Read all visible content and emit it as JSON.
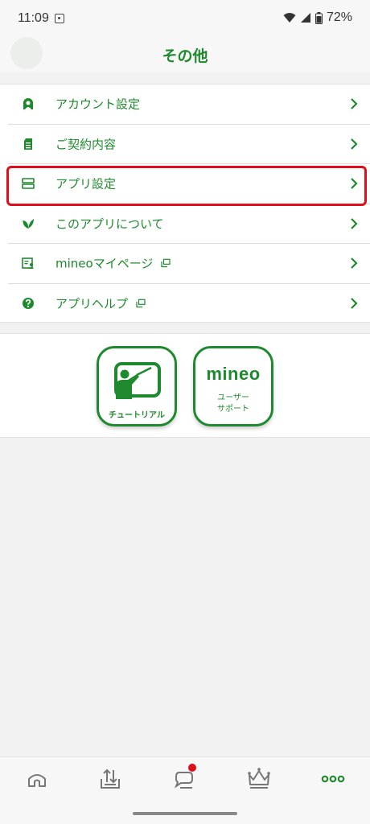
{
  "status_bar": {
    "time": "11:09",
    "battery": "72%"
  },
  "header": {
    "title": "その他"
  },
  "menu": {
    "items": [
      {
        "label": "アカウント設定",
        "icon": "person-icon",
        "external": false,
        "highlighted": false
      },
      {
        "label": "ご契約内容",
        "icon": "document-icon",
        "external": false,
        "highlighted": false
      },
      {
        "label": "アプリ設定",
        "icon": "settings-panel-icon",
        "external": false,
        "highlighted": true
      },
      {
        "label": "このアプリについて",
        "icon": "leaf-icon",
        "external": false,
        "highlighted": false
      },
      {
        "label": "mineoマイページ",
        "icon": "mypage-icon",
        "external": true,
        "highlighted": false
      },
      {
        "label": "アプリヘルプ",
        "icon": "help-icon",
        "external": true,
        "highlighted": false
      }
    ]
  },
  "shortcuts": {
    "tutorial_label": "チュートリアル",
    "support_logo": "mineo",
    "support_label_line1": "ユーザー",
    "support_label_line2": "サポート"
  },
  "bottom_nav": {
    "items": [
      "home-icon",
      "data-transfer-icon",
      "community-icon",
      "rank-crown-icon",
      "more-icon"
    ],
    "active": "more-icon"
  },
  "colors": {
    "accent": "#1e8a2d",
    "highlight": "#e00d1a",
    "badge": "#e00d1a"
  }
}
